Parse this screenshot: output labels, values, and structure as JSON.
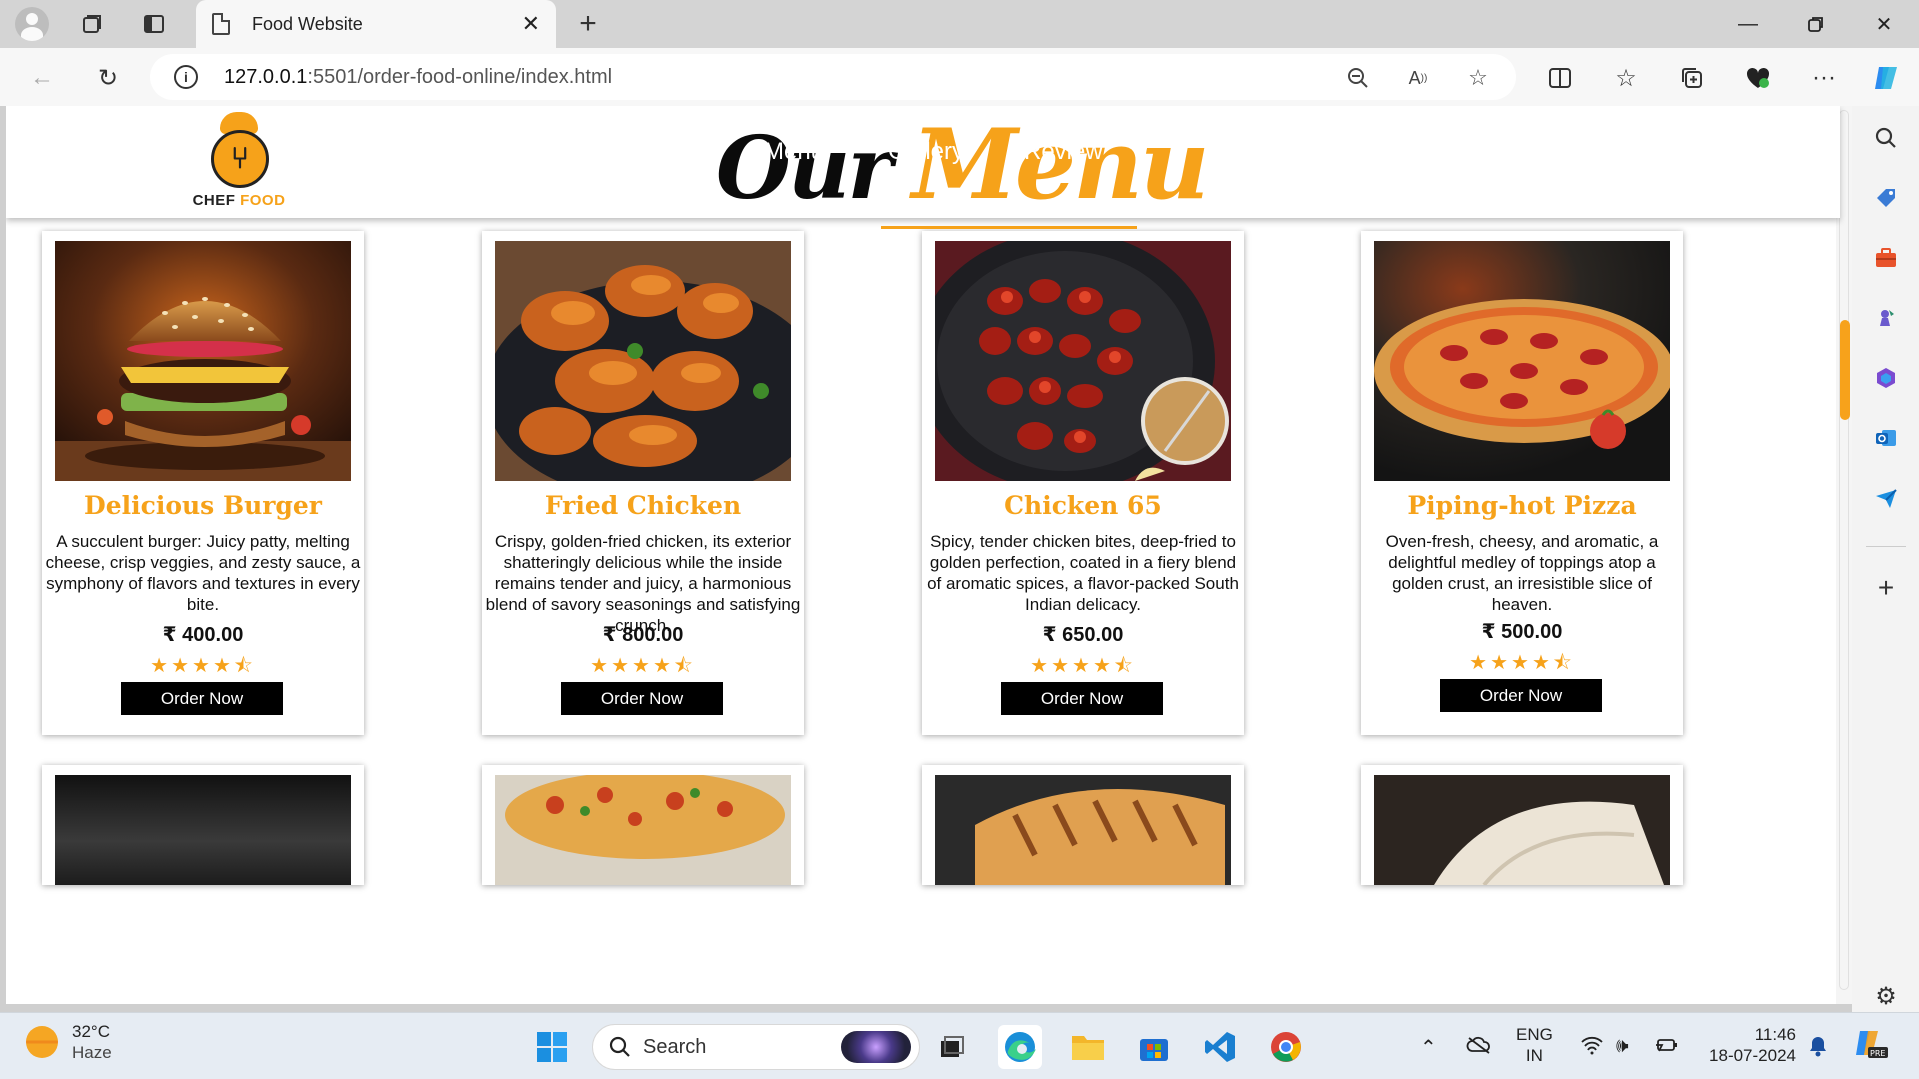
{
  "browser": {
    "tab_title": "Food Website",
    "url_host": "127.0.0.1",
    "url_path": ":5501/order-food-online/index.html",
    "icons": [
      "profile-icon",
      "workspaces-icon",
      "tab-actions-icon",
      "new-tab-icon",
      "back-icon",
      "refresh-icon",
      "info-icon",
      "zoom-out-icon",
      "read-aloud-icon",
      "favorite-star-icon",
      "split-screen-icon",
      "favorites-icon",
      "collections-icon",
      "browser-essentials-icon",
      "more-icon",
      "copilot-icon"
    ]
  },
  "site": {
    "logo_text_a": "CHEF",
    "logo_text_b": "FOOD",
    "heading_our": "Our",
    "heading_menu": "Menu",
    "nav_ghost": [
      "Menu",
      "Gallery",
      "Review"
    ],
    "currency": "₹"
  },
  "menu_items": [
    {
      "name": "Delicious Burger",
      "description": "A succulent burger: Juicy patty, melting cheese, crisp veggies, and zesty sauce, a symphony of flavors and textures in every bite.",
      "price": "₹ 400.00",
      "rating": 4.5,
      "stars": "★★★★⯪",
      "button": "Order Now"
    },
    {
      "name": "Fried Chicken",
      "description": "Crispy, golden-fried chicken, its exterior shatteringly delicious while the inside remains tender and juicy, a harmonious blend of savory seasonings and satisfying crunch.",
      "price": "₹ 800.00",
      "rating": 4.5,
      "stars": "★★★★⯪",
      "button": "Order Now"
    },
    {
      "name": "Chicken 65",
      "description": "Spicy, tender chicken bites, deep-fried to golden perfection, coated in a fiery blend of aromatic spices, a flavor-packed South Indian delicacy.",
      "price": "₹ 650.00",
      "rating": 4.5,
      "stars": "★★★★⯪",
      "button": "Order Now"
    },
    {
      "name": "Piping-hot Pizza",
      "description": "Oven-fresh, cheesy, and aromatic, a delightful medley of toppings atop a golden crust, an irresistible slice of heaven.",
      "price": "₹ 500.00",
      "rating": 4.5,
      "stars": "★★★★⯪",
      "button": "Order Now"
    }
  ],
  "taskbar": {
    "temperature": "32°C",
    "condition": "Haze",
    "search_label": "Search",
    "lang_a": "ENG",
    "lang_b": "IN",
    "time": "11:46",
    "date": "18-07-2024"
  },
  "colors": {
    "accent": "#f6a21a",
    "button_bg": "#000000",
    "header_shadow": "#bbbbbb"
  }
}
